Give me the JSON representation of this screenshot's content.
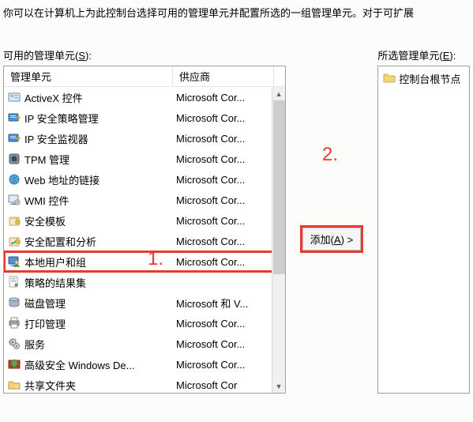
{
  "description": "你可以在计算机上为此控制台选择可用的管理单元并配置所选的一组管理单元。对于可扩展",
  "left": {
    "label_pre": "可用的管理单元(",
    "label_key": "S",
    "label_post": "):",
    "header_name": "管理单元",
    "header_vendor": "供应商",
    "items": [
      {
        "name": "ActiveX 控件",
        "vendor": "Microsoft Cor...",
        "icon": "activex"
      },
      {
        "name": "IP 安全策略管理",
        "vendor": "Microsoft Cor...",
        "icon": "ipsec-policy"
      },
      {
        "name": "IP 安全监视器",
        "vendor": "Microsoft Cor...",
        "icon": "ipsec-monitor"
      },
      {
        "name": "TPM 管理",
        "vendor": "Microsoft Cor...",
        "icon": "tpm"
      },
      {
        "name": "Web 地址的链接",
        "vendor": "Microsoft Cor...",
        "icon": "web-link"
      },
      {
        "name": "WMI 控件",
        "vendor": "Microsoft Cor...",
        "icon": "wmi"
      },
      {
        "name": "安全模板",
        "vendor": "Microsoft Cor...",
        "icon": "security-template"
      },
      {
        "name": "安全配置和分析",
        "vendor": "Microsoft Cor...",
        "icon": "security-config"
      },
      {
        "name": "本地用户和组",
        "vendor": "Microsoft Cor...",
        "icon": "local-users",
        "selected": true
      },
      {
        "name": "策略的结果集",
        "vendor": "",
        "icon": "rsop"
      },
      {
        "name": "磁盘管理",
        "vendor": "Microsoft 和 V...",
        "icon": "disk-mgmt"
      },
      {
        "name": "打印管理",
        "vendor": "Microsoft Cor...",
        "icon": "print-mgmt"
      },
      {
        "name": "服务",
        "vendor": "Microsoft Cor...",
        "icon": "services"
      },
      {
        "name": "高级安全 Windows De...",
        "vendor": "Microsoft Cor...",
        "icon": "firewall"
      },
      {
        "name": "共享文件夹",
        "vendor": "Microsoft Cor",
        "icon": "shared-folder"
      }
    ]
  },
  "center": {
    "add_pre": "添加(",
    "add_key": "A",
    "add_post": ") >"
  },
  "right": {
    "label_pre": "所选管理单元(",
    "label_key": "E",
    "label_post": "):",
    "root": "控制台根节点"
  },
  "annotations": {
    "one": "1.",
    "two": "2."
  }
}
